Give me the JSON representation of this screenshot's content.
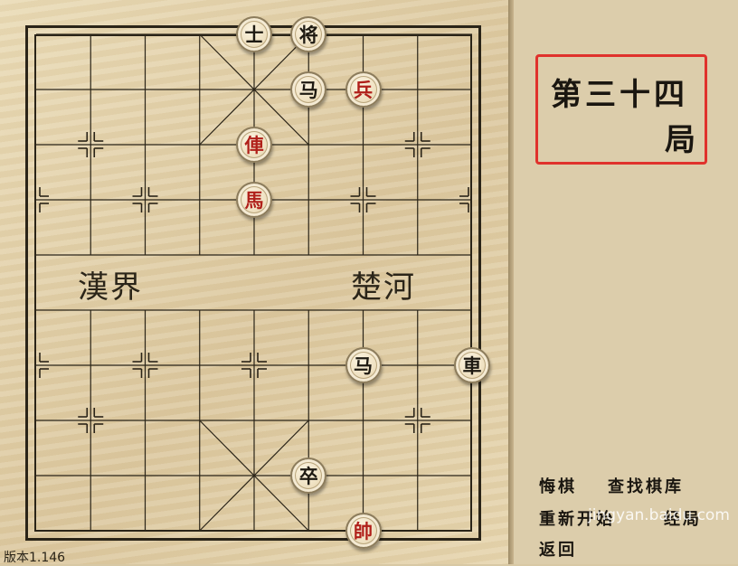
{
  "board": {
    "river_left": "漢界",
    "river_right": "楚河",
    "pieces": [
      {
        "char": "士",
        "side": "black",
        "col": 4,
        "row": 0
      },
      {
        "char": "将",
        "side": "black",
        "col": 5,
        "row": 0
      },
      {
        "char": "马",
        "side": "black",
        "col": 5,
        "row": 1
      },
      {
        "char": "兵",
        "side": "red",
        "col": 6,
        "row": 1
      },
      {
        "char": "俥",
        "side": "red",
        "col": 4,
        "row": 2
      },
      {
        "char": "馬",
        "side": "red",
        "col": 4,
        "row": 3
      },
      {
        "char": "马",
        "side": "black",
        "col": 6,
        "row": 6
      },
      {
        "char": "車",
        "side": "black",
        "col": 8,
        "row": 6
      },
      {
        "char": "卒",
        "side": "black",
        "col": 5,
        "row": 8
      },
      {
        "char": "帥",
        "side": "red",
        "col": 6,
        "row": 9
      }
    ]
  },
  "title": {
    "line1": "第三十四",
    "line2": "局"
  },
  "menu": {
    "undo": "悔棋",
    "search_library": "查找棋库",
    "restart": "重新开始",
    "manual": "经局",
    "back": "返回"
  },
  "watermark": "jingyan.baidu.com",
  "version": "版本1.146",
  "colors": {
    "red_piece": "#b0201a",
    "black_piece": "#1e1a12",
    "title_border": "#e0322c"
  }
}
